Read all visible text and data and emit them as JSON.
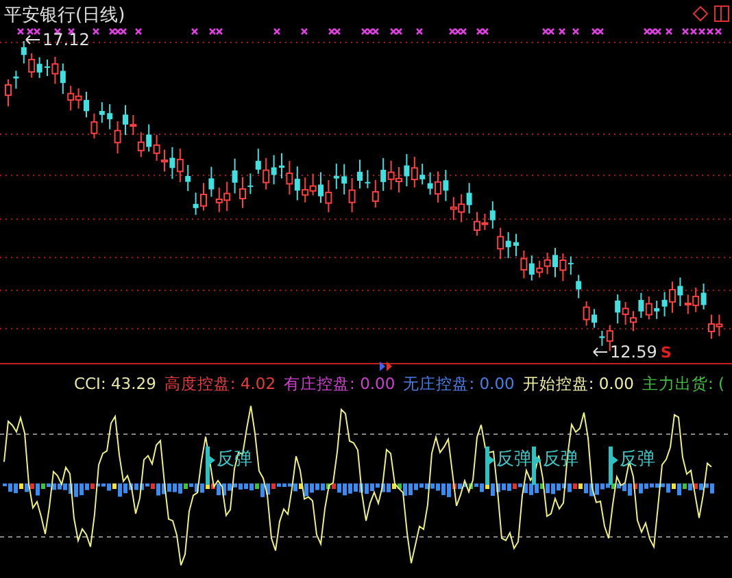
{
  "chart_title": "平安银行(日线)",
  "high_label": "17.12",
  "low_label": "12.59",
  "sell_mark": "S",
  "indicator_values": [
    {
      "text": "CCI: 43.29",
      "color": "#e8e8a0"
    },
    {
      "text": "高度控盘: 4.02",
      "color": "#e83c3c"
    },
    {
      "text": "有庄控盘: 0.00",
      "color": "#d040d0"
    },
    {
      "text": "无庄控盘: 0.00",
      "color": "#4a7ee8"
    },
    {
      "text": "开始控盘: 0.00",
      "color": "#f0f0a0"
    },
    {
      "text": "主力出货: (",
      "color": "#40c040"
    }
  ],
  "signals": [
    {
      "text": "反弹"
    },
    {
      "text": "反弹"
    },
    {
      "text": "反弹"
    },
    {
      "text": "反弹"
    }
  ]
}
